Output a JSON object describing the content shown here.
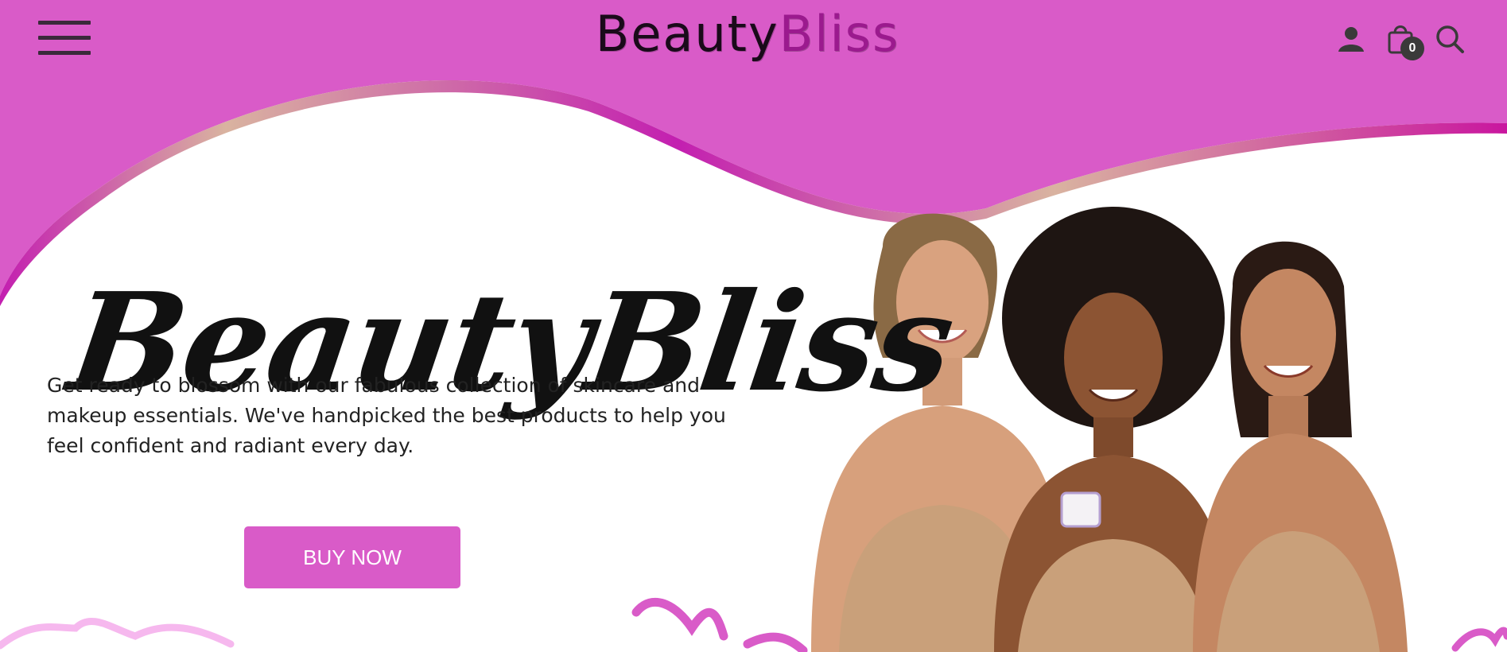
{
  "header": {
    "logo_main": "Beauty",
    "logo_accent": "Bliss",
    "cart_count": "0",
    "icons": [
      "menu-icon",
      "user-icon",
      "shopping-bag-icon",
      "search-icon"
    ]
  },
  "hero": {
    "title": "BeautyBliss",
    "description": "Get ready to blossom with our fabulous collection of skincare and makeup essentials. We've handpicked the best products to help you feel confident and radiant every day.",
    "cta_label": "BUY NOW"
  },
  "colors": {
    "brand_pink": "#d95bc8",
    "deep_magenta": "#c31fb0",
    "gold_accent": "#d9b3a0",
    "text_dark": "#222222"
  }
}
